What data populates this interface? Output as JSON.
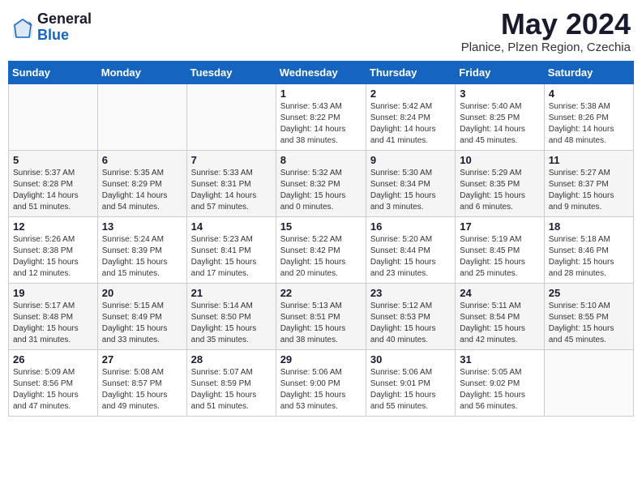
{
  "header": {
    "logo_general": "General",
    "logo_blue": "Blue",
    "month_year": "May 2024",
    "location": "Planice, Plzen Region, Czechia"
  },
  "days_of_week": [
    "Sunday",
    "Monday",
    "Tuesday",
    "Wednesday",
    "Thursday",
    "Friday",
    "Saturday"
  ],
  "weeks": [
    [
      {
        "day": "",
        "info": ""
      },
      {
        "day": "",
        "info": ""
      },
      {
        "day": "",
        "info": ""
      },
      {
        "day": "1",
        "info": "Sunrise: 5:43 AM\nSunset: 8:22 PM\nDaylight: 14 hours\nand 38 minutes."
      },
      {
        "day": "2",
        "info": "Sunrise: 5:42 AM\nSunset: 8:24 PM\nDaylight: 14 hours\nand 41 minutes."
      },
      {
        "day": "3",
        "info": "Sunrise: 5:40 AM\nSunset: 8:25 PM\nDaylight: 14 hours\nand 45 minutes."
      },
      {
        "day": "4",
        "info": "Sunrise: 5:38 AM\nSunset: 8:26 PM\nDaylight: 14 hours\nand 48 minutes."
      }
    ],
    [
      {
        "day": "5",
        "info": "Sunrise: 5:37 AM\nSunset: 8:28 PM\nDaylight: 14 hours\nand 51 minutes."
      },
      {
        "day": "6",
        "info": "Sunrise: 5:35 AM\nSunset: 8:29 PM\nDaylight: 14 hours\nand 54 minutes."
      },
      {
        "day": "7",
        "info": "Sunrise: 5:33 AM\nSunset: 8:31 PM\nDaylight: 14 hours\nand 57 minutes."
      },
      {
        "day": "8",
        "info": "Sunrise: 5:32 AM\nSunset: 8:32 PM\nDaylight: 15 hours\nand 0 minutes."
      },
      {
        "day": "9",
        "info": "Sunrise: 5:30 AM\nSunset: 8:34 PM\nDaylight: 15 hours\nand 3 minutes."
      },
      {
        "day": "10",
        "info": "Sunrise: 5:29 AM\nSunset: 8:35 PM\nDaylight: 15 hours\nand 6 minutes."
      },
      {
        "day": "11",
        "info": "Sunrise: 5:27 AM\nSunset: 8:37 PM\nDaylight: 15 hours\nand 9 minutes."
      }
    ],
    [
      {
        "day": "12",
        "info": "Sunrise: 5:26 AM\nSunset: 8:38 PM\nDaylight: 15 hours\nand 12 minutes."
      },
      {
        "day": "13",
        "info": "Sunrise: 5:24 AM\nSunset: 8:39 PM\nDaylight: 15 hours\nand 15 minutes."
      },
      {
        "day": "14",
        "info": "Sunrise: 5:23 AM\nSunset: 8:41 PM\nDaylight: 15 hours\nand 17 minutes."
      },
      {
        "day": "15",
        "info": "Sunrise: 5:22 AM\nSunset: 8:42 PM\nDaylight: 15 hours\nand 20 minutes."
      },
      {
        "day": "16",
        "info": "Sunrise: 5:20 AM\nSunset: 8:44 PM\nDaylight: 15 hours\nand 23 minutes."
      },
      {
        "day": "17",
        "info": "Sunrise: 5:19 AM\nSunset: 8:45 PM\nDaylight: 15 hours\nand 25 minutes."
      },
      {
        "day": "18",
        "info": "Sunrise: 5:18 AM\nSunset: 8:46 PM\nDaylight: 15 hours\nand 28 minutes."
      }
    ],
    [
      {
        "day": "19",
        "info": "Sunrise: 5:17 AM\nSunset: 8:48 PM\nDaylight: 15 hours\nand 31 minutes."
      },
      {
        "day": "20",
        "info": "Sunrise: 5:15 AM\nSunset: 8:49 PM\nDaylight: 15 hours\nand 33 minutes."
      },
      {
        "day": "21",
        "info": "Sunrise: 5:14 AM\nSunset: 8:50 PM\nDaylight: 15 hours\nand 35 minutes."
      },
      {
        "day": "22",
        "info": "Sunrise: 5:13 AM\nSunset: 8:51 PM\nDaylight: 15 hours\nand 38 minutes."
      },
      {
        "day": "23",
        "info": "Sunrise: 5:12 AM\nSunset: 8:53 PM\nDaylight: 15 hours\nand 40 minutes."
      },
      {
        "day": "24",
        "info": "Sunrise: 5:11 AM\nSunset: 8:54 PM\nDaylight: 15 hours\nand 42 minutes."
      },
      {
        "day": "25",
        "info": "Sunrise: 5:10 AM\nSunset: 8:55 PM\nDaylight: 15 hours\nand 45 minutes."
      }
    ],
    [
      {
        "day": "26",
        "info": "Sunrise: 5:09 AM\nSunset: 8:56 PM\nDaylight: 15 hours\nand 47 minutes."
      },
      {
        "day": "27",
        "info": "Sunrise: 5:08 AM\nSunset: 8:57 PM\nDaylight: 15 hours\nand 49 minutes."
      },
      {
        "day": "28",
        "info": "Sunrise: 5:07 AM\nSunset: 8:59 PM\nDaylight: 15 hours\nand 51 minutes."
      },
      {
        "day": "29",
        "info": "Sunrise: 5:06 AM\nSunset: 9:00 PM\nDaylight: 15 hours\nand 53 minutes."
      },
      {
        "day": "30",
        "info": "Sunrise: 5:06 AM\nSunset: 9:01 PM\nDaylight: 15 hours\nand 55 minutes."
      },
      {
        "day": "31",
        "info": "Sunrise: 5:05 AM\nSunset: 9:02 PM\nDaylight: 15 hours\nand 56 minutes."
      },
      {
        "day": "",
        "info": ""
      }
    ]
  ]
}
